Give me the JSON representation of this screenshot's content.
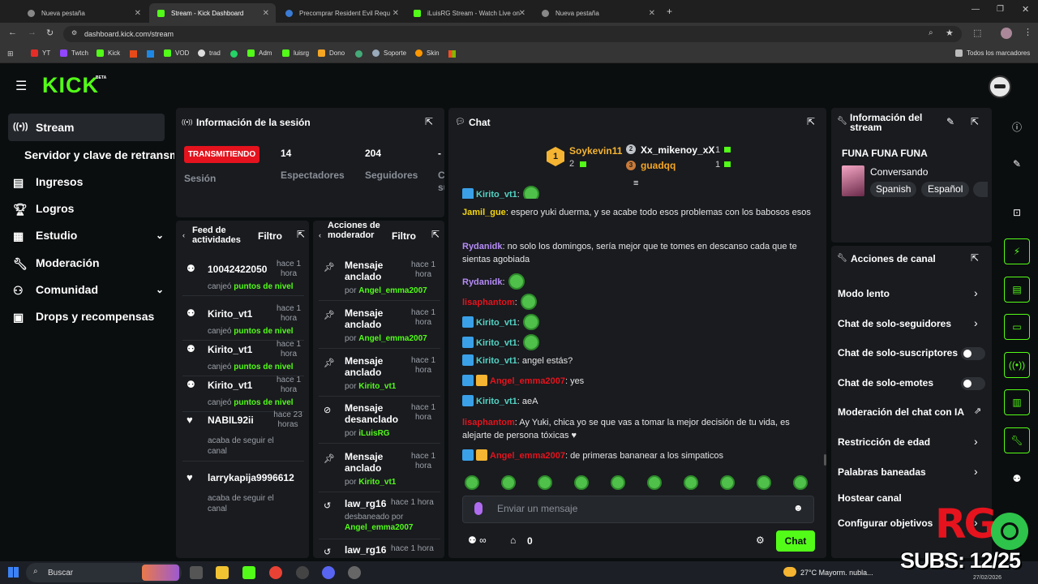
{
  "browser": {
    "tabs": [
      {
        "title": "Nueva pestaña"
      },
      {
        "title": "Stream - Kick Dashboard"
      },
      {
        "title": "Precomprar Resident Evil Requ"
      },
      {
        "title": "iLuisRG Stream - Watch Live on"
      },
      {
        "title": "Nueva pestaña"
      }
    ],
    "url": "dashboard.kick.com/stream",
    "bookmarks": [
      "YT",
      "Twtch",
      "Kick",
      "VOD",
      "trad",
      "Adm",
      "luisrg",
      "Dono",
      "Soporte",
      "Skin"
    ],
    "all_bookmarks": "Todos los marcadores"
  },
  "header": {
    "logo": "KICK",
    "beta": "BETA"
  },
  "sidebar": {
    "items": [
      {
        "label": "Stream"
      },
      {
        "label": "Servidor y clave de retransm"
      },
      {
        "label": "Ingresos"
      },
      {
        "label": "Logros"
      },
      {
        "label": "Estudio"
      },
      {
        "label": "Moderación"
      },
      {
        "label": "Comunidad"
      },
      {
        "label": "Drops y recompensas"
      }
    ]
  },
  "session": {
    "title": "Información de la sesión",
    "status": "TRANSMITIENDO",
    "session_label": "Sesión",
    "stats": [
      {
        "value": "14",
        "label": "Espectadores"
      },
      {
        "value": "204",
        "label": "Seguidores"
      },
      {
        "value": "-",
        "label": "Ca su"
      }
    ]
  },
  "feed": {
    "title": "Feed de actividades",
    "filter": "Filtro",
    "items": [
      {
        "name": "10042422050",
        "time": "hace 1 hora",
        "pre": "canjeó",
        "highlight": "puntos de nivel"
      },
      {
        "name": "Kirito_vt1",
        "time": "hace 1 hora",
        "pre": "canjeó",
        "highlight": "puntos de nivel"
      },
      {
        "name": "Kirito_vt1",
        "time": "hace 1 hora",
        "pre": "canjeó",
        "highlight": "puntos de nivel"
      },
      {
        "name": "Kirito_vt1",
        "time": "hace 1 hora",
        "pre": "canjeó",
        "highlight": "puntos de nivel"
      },
      {
        "name": "NABIL92ii",
        "time": "hace 23 horas",
        "pre": "acaba de seguir el canal",
        "highlight": ""
      },
      {
        "name": "larrykapija9996612",
        "time": "",
        "pre": "acaba de seguir el canal",
        "highlight": ""
      }
    ]
  },
  "mod": {
    "title": "Acciones de moderador",
    "filter": "Filtro",
    "items": [
      {
        "title": "Mensaje anclado",
        "time": "hace 1 hora",
        "by": "por",
        "user": "Angel_emma2007"
      },
      {
        "title": "Mensaje anclado",
        "time": "hace 1 hora",
        "by": "por",
        "user": "Angel_emma2007"
      },
      {
        "title": "Mensaje anclado",
        "time": "hace 1 hora",
        "by": "por",
        "user": "Kirito_vt1"
      },
      {
        "title": "Mensaje desanclado",
        "time": "hace 1 hora",
        "by": "por",
        "user": "iLuisRG"
      },
      {
        "title": "Mensaje anclado",
        "time": "hace 1 hora",
        "by": "por",
        "user": "Kirito_vt1"
      },
      {
        "title": "law_rg16",
        "time": "hace 1 hora",
        "by": "desbaneado por",
        "user": "Angel_emma2007"
      },
      {
        "title": "law_rg16",
        "time": "hace 1 hora",
        "by": "",
        "user": ""
      }
    ]
  },
  "chat": {
    "title": "Chat",
    "leaders": [
      {
        "rank": "1",
        "name": "Soykevin11",
        "count": "2"
      },
      {
        "rank": "2",
        "name": "Xx_mikenoy_xX",
        "count": "1"
      },
      {
        "rank": "3",
        "name": "guadqq",
        "count": "1"
      }
    ],
    "messages": [
      {
        "user": "Kirito_vt1",
        "text": ":"
      },
      {
        "user": "Jamil_gue",
        "text": ": espero yuki duerma, y se acabe todo esos problemas con los babosos esos"
      },
      {
        "user": "Rydanidk",
        "text": ": no solo los domingos, sería mejor que te tomes en descanso cada que te sientas agobiada"
      },
      {
        "user": "Rydanidk",
        "text": ":"
      },
      {
        "user": "lisaphantom",
        "text": ":"
      },
      {
        "user": "Kirito_vt1",
        "text": ":"
      },
      {
        "user": "Kirito_vt1",
        "text": ":"
      },
      {
        "user": "Kirito_vt1",
        "text": ": angel estás?"
      },
      {
        "user": "Angel_emma2007",
        "text": ": yes"
      },
      {
        "user": "Kirito_vt1",
        "text": ": aeA"
      },
      {
        "user": "lisaphantom",
        "text": ": Ay Yuki, chica yo se que vas a tomar la mejor decisión de tu vida, es alejarte de persona tóxicas ♥"
      },
      {
        "user": "Angel_emma2007",
        "text": ": de primeras bananear a los simpaticos"
      }
    ],
    "placeholder": "Enviar un mensaje",
    "points": "0",
    "send": "Chat"
  },
  "stream_info": {
    "title": "Información del stream",
    "stream_title": "FUNA FUNA FUNA",
    "category": "Conversando",
    "tags": [
      "Spanish",
      "Español"
    ]
  },
  "channel_actions": {
    "title": "Acciones de canal",
    "items": [
      {
        "label": "Modo lento",
        "type": "chevron"
      },
      {
        "label": "Chat de solo-seguidores",
        "type": "chevron"
      },
      {
        "label": "Chat de solo-suscriptores",
        "type": "toggle"
      },
      {
        "label": "Chat de solo-emotes",
        "type": "toggle"
      },
      {
        "label": "Moderación del chat con IA",
        "type": "external"
      },
      {
        "label": "Restricción de edad",
        "type": "chevron"
      },
      {
        "label": "Palabras baneadas",
        "type": "chevron"
      },
      {
        "label": "Hostear canal",
        "type": "none"
      },
      {
        "label": "Configurar objetivos",
        "type": "chevron"
      }
    ]
  },
  "overlay": {
    "rg": "RG",
    "subs": "SUBS: 12/25"
  },
  "taskbar": {
    "search": "Buscar",
    "weather": "27°C  Mayorm. nubla...",
    "date": "27/02/2026"
  },
  "colors": {
    "brand": "#53fc18",
    "live": "#e5131d",
    "panel": "#191b1f",
    "bg": "#0b0e0f"
  }
}
